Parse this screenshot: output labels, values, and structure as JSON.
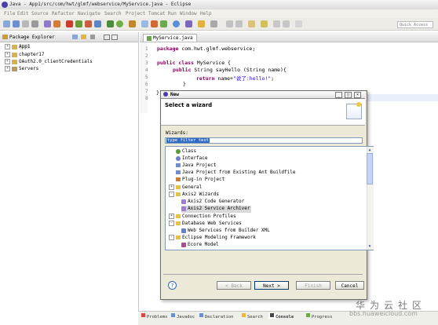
{
  "window": {
    "title": "Java - App1/src/com/hwt/glmf/webservice/MyService.java - Eclipse"
  },
  "menu": [
    "File",
    "Edit",
    "Source",
    "Refactor",
    "Navigate",
    "Search",
    "Project",
    "Tomcat",
    "Run",
    "Window",
    "Help"
  ],
  "toolbar": {
    "quick_access": "Quick Access"
  },
  "package_explorer": {
    "title": "Package Explorer",
    "items": [
      "App1",
      "chapter17",
      "OAuth2.0_clientCredentials",
      "Servers"
    ]
  },
  "editor": {
    "tab": "MyService.java",
    "line_numbers": [
      "1",
      "2",
      "3",
      "4",
      "5",
      "6",
      "7",
      "8"
    ],
    "code": {
      "l1_kw": "package",
      "l1_rest": " com.hwt.glmf.webservice;",
      "l3_kw": "public class",
      "l3_rest": " MyService {",
      "l4_kw": "public",
      "l4_rest": " String sayHello (String name){",
      "l5_kw": "return",
      "l5_a": " name+",
      "l5_str": "\"说了:hello!\"",
      "l5_end": ";",
      "l6": "}",
      "l7": "}"
    }
  },
  "bottom_tabs": [
    "Problems",
    "Javadoc",
    "Declaration",
    "Search",
    "Console",
    "Progress"
  ],
  "dialog": {
    "title": "New",
    "heading": "Select a wizard",
    "wizards_label": "Wizards:",
    "filter_text": "type filter text",
    "list": [
      {
        "label": "Class",
        "type": "item",
        "indent": 1
      },
      {
        "label": "Interface",
        "type": "item",
        "indent": 1
      },
      {
        "label": "Java Project",
        "type": "item",
        "indent": 1
      },
      {
        "label": "Java Project from Existing Ant Buildfile",
        "type": "item",
        "indent": 1
      },
      {
        "label": "Plug-in Project",
        "type": "item",
        "indent": 1
      },
      {
        "label": "General",
        "type": "folder",
        "indent": 0,
        "expanded": false
      },
      {
        "label": "Axis2 Wizards",
        "type": "folder",
        "indent": 0,
        "expanded": true
      },
      {
        "label": "Axis2 Code Generator",
        "type": "item",
        "indent": 2
      },
      {
        "label": "Axis2 Service Archiver",
        "type": "item",
        "indent": 2,
        "selected": true
      },
      {
        "label": "Connection Profiles",
        "type": "folder",
        "indent": 0,
        "expanded": false
      },
      {
        "label": "Database Web Services",
        "type": "folder",
        "indent": 0,
        "expanded": true
      },
      {
        "label": "Web Services from Builder XML",
        "type": "item",
        "indent": 2
      },
      {
        "label": "Eclipse Modeling Framework",
        "type": "folder",
        "indent": 0,
        "expanded": true
      },
      {
        "label": "Ecore Model",
        "type": "item",
        "indent": 2
      }
    ],
    "buttons": {
      "help": "?",
      "back": "< Back",
      "next": "Next >",
      "finish": "Finish",
      "cancel": "Cancel"
    }
  },
  "watermark": {
    "cn": "华为云社区",
    "url": "bbs.huaweicloud.com"
  }
}
